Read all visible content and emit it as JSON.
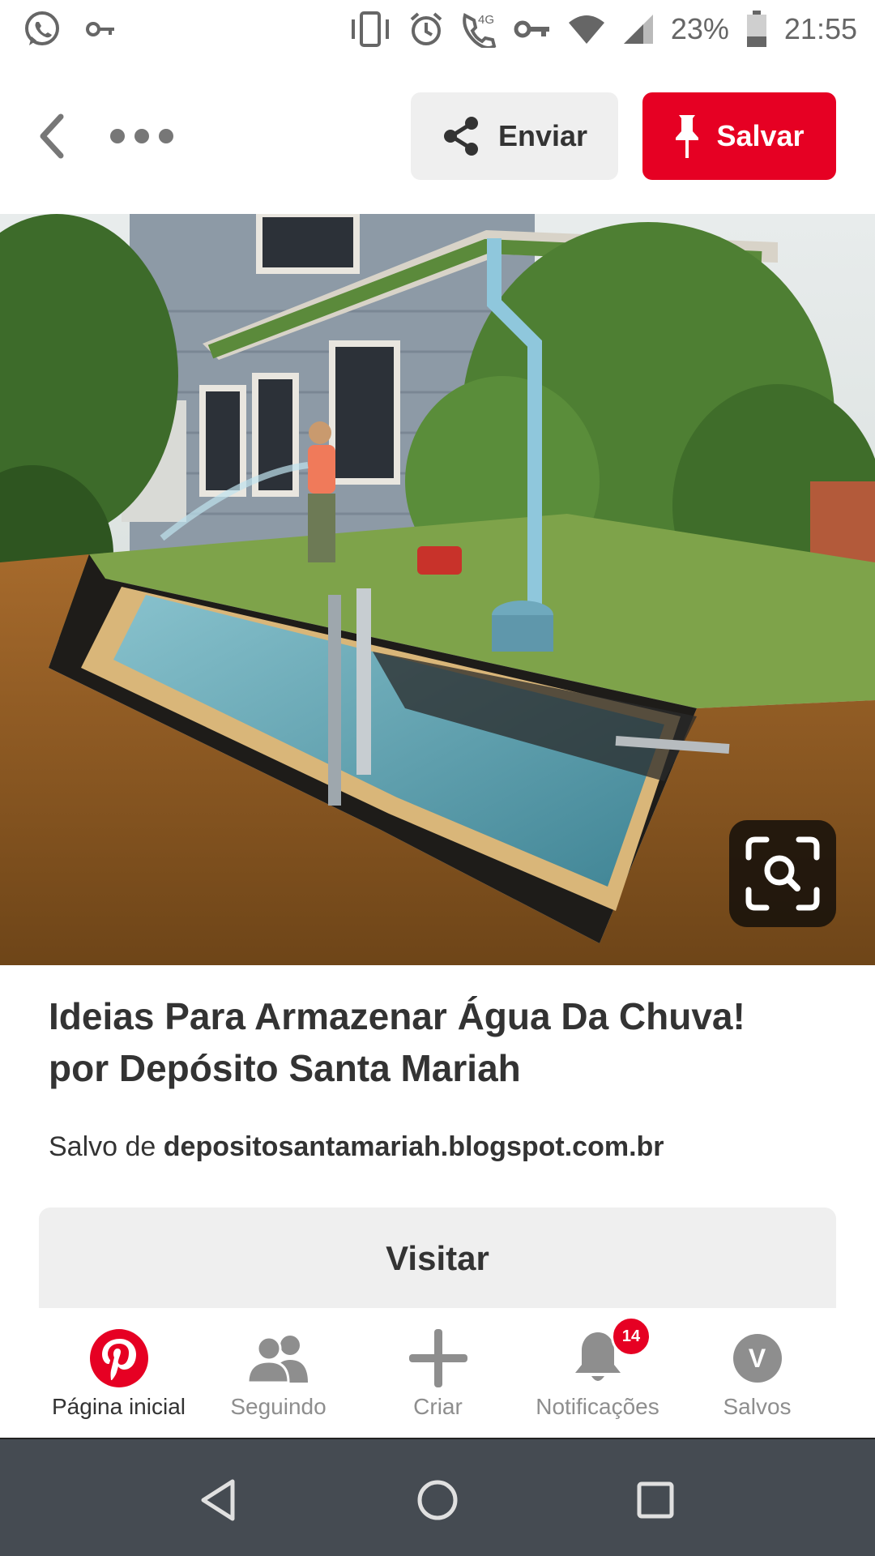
{
  "status_bar": {
    "battery_text": "23%",
    "time": "21:55",
    "network_label": "4G",
    "icons": [
      "whatsapp-icon",
      "key-icon",
      "vibrate-icon",
      "alarm-icon",
      "volte-call-icon",
      "vpn-key-icon",
      "wifi-icon",
      "signal-icon",
      "battery-icon"
    ]
  },
  "toolbar": {
    "send_label": "Enviar",
    "save_label": "Salvar"
  },
  "pin": {
    "title_line1": "Ideias Para Armazenar Água Da Chuva!",
    "title_line2": "por Depósito Santa Mariah",
    "saved_prefix": "Salvo de",
    "saved_source": "depositosantamariah.blogspot.com.br",
    "visit_label": "Visitar"
  },
  "tabs": [
    {
      "label": "Página inicial",
      "icon": "pinterest-logo-icon",
      "active": true
    },
    {
      "label": "Seguindo",
      "icon": "people-icon",
      "active": false
    },
    {
      "label": "Criar",
      "icon": "plus-icon",
      "active": false
    },
    {
      "label": "Notificações",
      "icon": "bell-icon",
      "active": false,
      "badge": "14"
    },
    {
      "label": "Salvos",
      "icon": "avatar",
      "active": false,
      "avatar_letter": "V"
    }
  ],
  "colors": {
    "brand_red": "#e60023",
    "nav_bar": "#454b52",
    "button_gray": "#efefef"
  }
}
